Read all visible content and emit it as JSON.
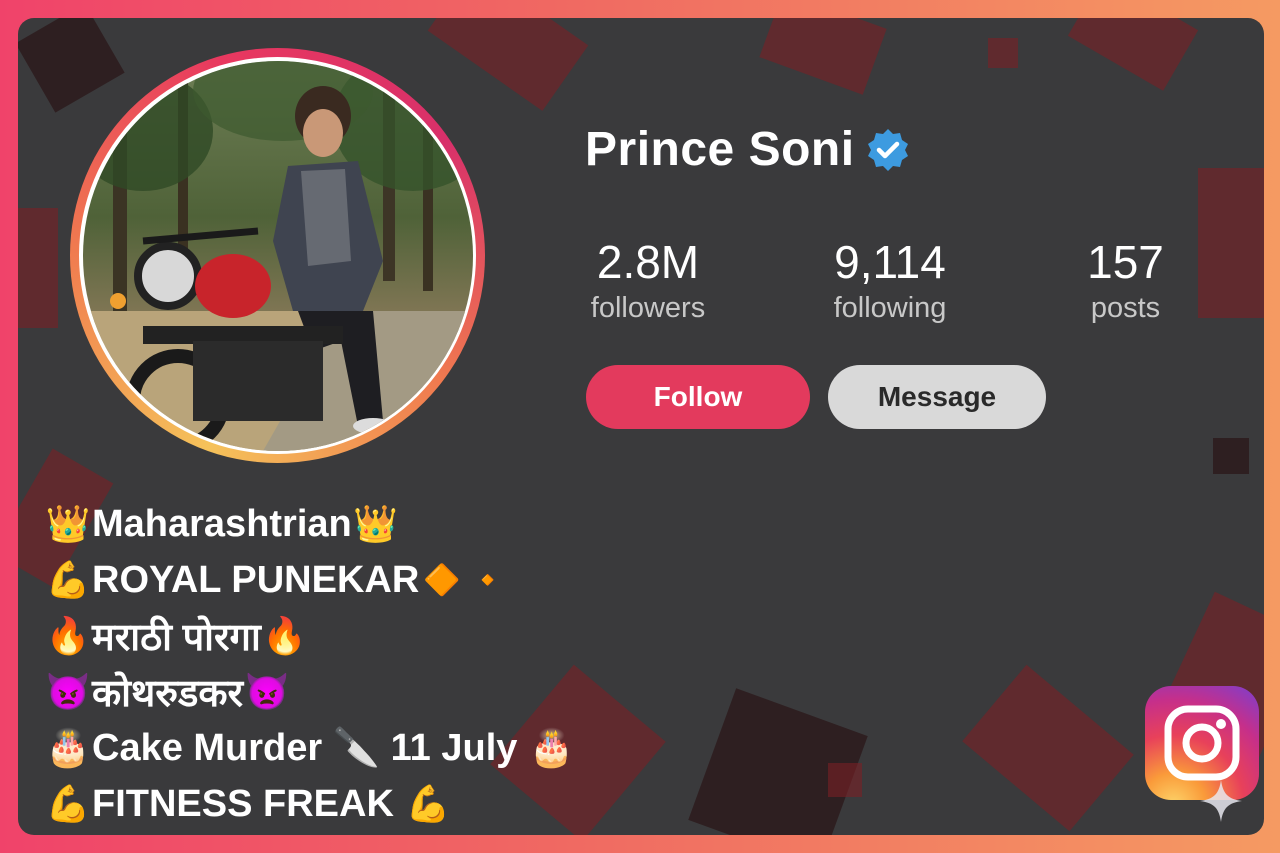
{
  "profile": {
    "name": "Prince Soni",
    "verified": true,
    "avatar_description": "photo of young man sitting on a red motorcycle in a pine forest"
  },
  "stats": [
    {
      "value": "2.8M",
      "label": "followers"
    },
    {
      "value": "9,114",
      "label": "following"
    },
    {
      "value": "157",
      "label": "posts"
    }
  ],
  "actions": {
    "follow": "Follow",
    "message": "Message"
  },
  "bio": [
    {
      "prefix": "👑",
      "text": "Maharashtrian",
      "suffix": "👑"
    },
    {
      "prefix": "💪",
      "text": "ROYAL PUNEKAR",
      "suffix": "🔶 🔸"
    },
    {
      "prefix": "🔥",
      "text": "मराठी पोरगा",
      "suffix": "🔥"
    },
    {
      "prefix": "👿",
      "text": "कोथरुडकर",
      "suffix": "👿"
    },
    {
      "prefix": "🎂",
      "text": "Cake Murder 🔪 11 July",
      "suffix": "🎂"
    },
    {
      "prefix": "💪",
      "text": "FITNESS FREAK",
      "suffix": "💪"
    }
  ],
  "colors": {
    "frame_gradient_start": "#f0436a",
    "frame_gradient_end": "#f59a62",
    "card_background": "#3a3a3c",
    "follow_button": "#e33a5d",
    "message_button": "#d9d9d9",
    "verified_badge": "#3d9be0"
  },
  "icons": {
    "verified": "verified-badge-icon",
    "app_logo": "instagram-icon"
  }
}
